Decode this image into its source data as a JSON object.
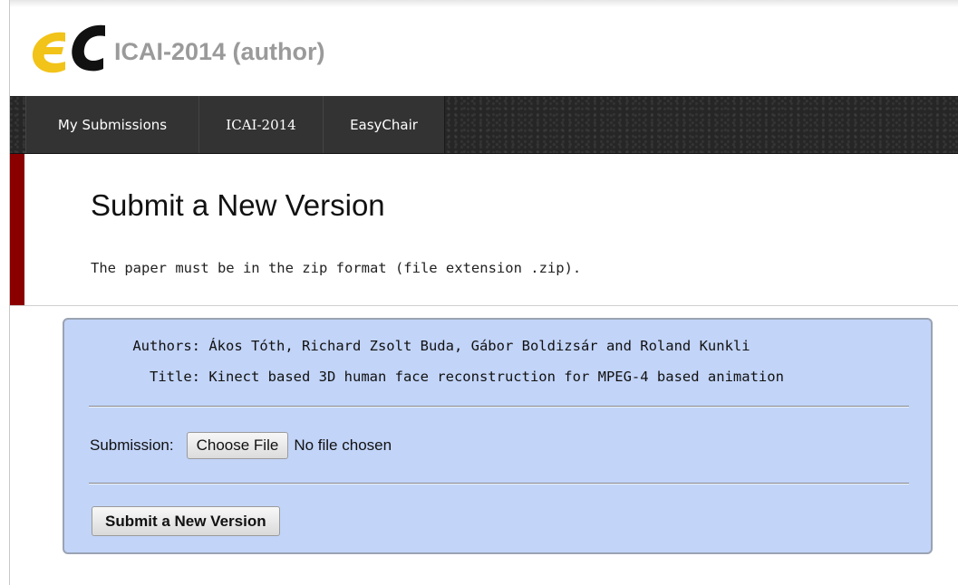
{
  "header": {
    "logo_name": "easychair-logo",
    "app_title": "ICAI-2014 (author)"
  },
  "nav": {
    "items": [
      {
        "label": "My Submissions"
      },
      {
        "label": "ICAI-2014"
      },
      {
        "label": "EasyChair"
      }
    ]
  },
  "page": {
    "title": "Submit a New Version",
    "note": "The paper must be in the zip format (file extension .zip)."
  },
  "form": {
    "authors_label": "Authors:",
    "authors_value": "Ákos Tóth, Richard Zsolt Buda, Gábor Boldizsár and Roland Kunkli",
    "title_label": "Title:",
    "title_value": "Kinect based 3D human face reconstruction for MPEG-4 based animation",
    "submission_label": "Submission:",
    "choose_file_label": "Choose File",
    "file_status": "No file chosen",
    "submit_label": "Submit a New Version"
  },
  "colors": {
    "logo_yellow": "#f2c318",
    "logo_black": "#111111",
    "nav_background": "#262626",
    "title_accent": "#8a0000",
    "panel_background": "#c2d4f8"
  }
}
